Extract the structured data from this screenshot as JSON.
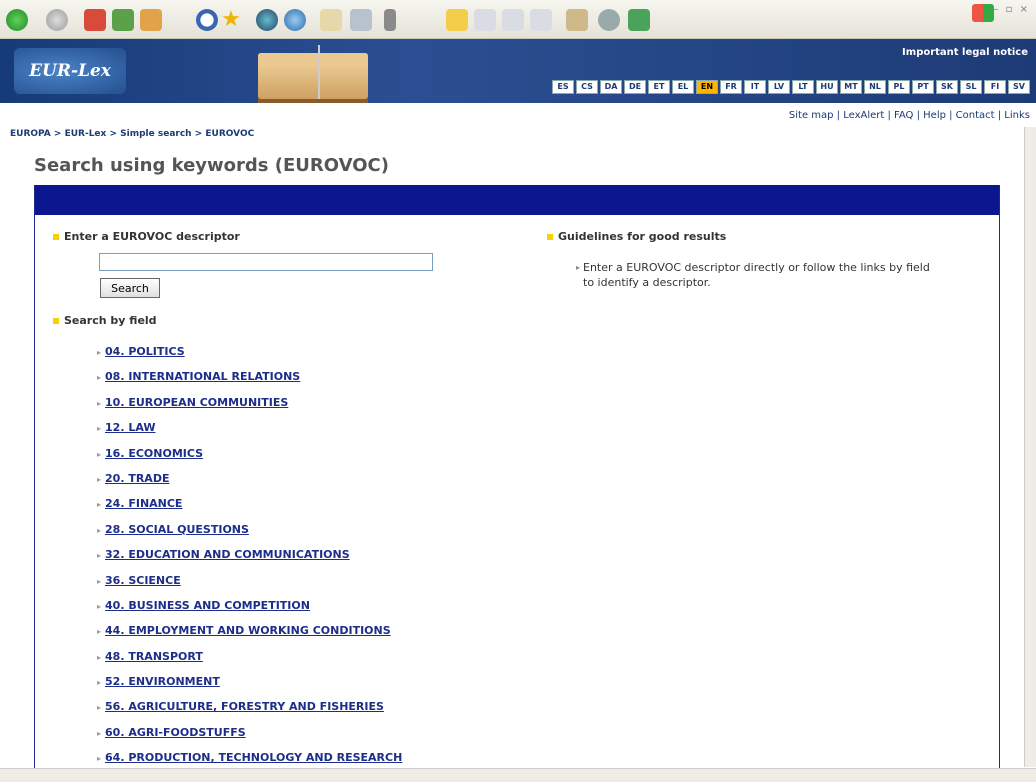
{
  "header": {
    "logo_text": "EUR-Lex",
    "legal_notice": "Important legal notice",
    "languages": [
      "ES",
      "CS",
      "DA",
      "DE",
      "ET",
      "EL",
      "EN",
      "FR",
      "IT",
      "LV",
      "LT",
      "HU",
      "MT",
      "NL",
      "PL",
      "PT",
      "SK",
      "SL",
      "FI",
      "SV"
    ],
    "active_language": "EN",
    "top_links": "Site map | LexAlert | FAQ | Help | Contact | Links"
  },
  "breadcrumb": "EUROPA > EUR-Lex > Simple search > EUROVOC",
  "page_title": "Search using keywords (EUROVOC)",
  "search": {
    "section_label": "Enter a EUROVOC descriptor",
    "input_value": "",
    "button_label": "Search"
  },
  "guidelines": {
    "heading": "Guidelines for good results",
    "text": "Enter a EUROVOC descriptor directly or follow the links by field to identify a descriptor."
  },
  "fields": {
    "heading": "Search by field",
    "items": [
      "04. POLITICS",
      "08. INTERNATIONAL RELATIONS",
      "10. EUROPEAN COMMUNITIES",
      "12. LAW",
      "16. ECONOMICS",
      "20. TRADE",
      "24. FINANCE",
      "28. SOCIAL QUESTIONS",
      "32. EDUCATION AND COMMUNICATIONS",
      "36. SCIENCE",
      "40. BUSINESS AND COMPETITION",
      "44. EMPLOYMENT AND WORKING CONDITIONS",
      "48. TRANSPORT",
      "52. ENVIRONMENT",
      "56. AGRICULTURE, FORESTRY AND FISHERIES",
      "60. AGRI-FOODSTUFFS",
      "64. PRODUCTION, TECHNOLOGY AND RESEARCH"
    ]
  },
  "colors": {
    "header_blue": "#1c3a76",
    "panel_bar": "#0b168f",
    "bullet": "#f7d200",
    "link": "#1c2d8a"
  },
  "toolbar_icons": [
    "back-icon",
    "forward-icon",
    "stop-icon",
    "refresh-icon",
    "home-icon",
    "search-icon",
    "favorites-icon",
    "media-icon",
    "history-icon",
    "mail-icon",
    "print-icon",
    "edit-icon",
    "folder-icon",
    "page-icon",
    "page-icon-2",
    "page-icon-3",
    "research-icon",
    "messenger-icon",
    "extension-icon"
  ]
}
